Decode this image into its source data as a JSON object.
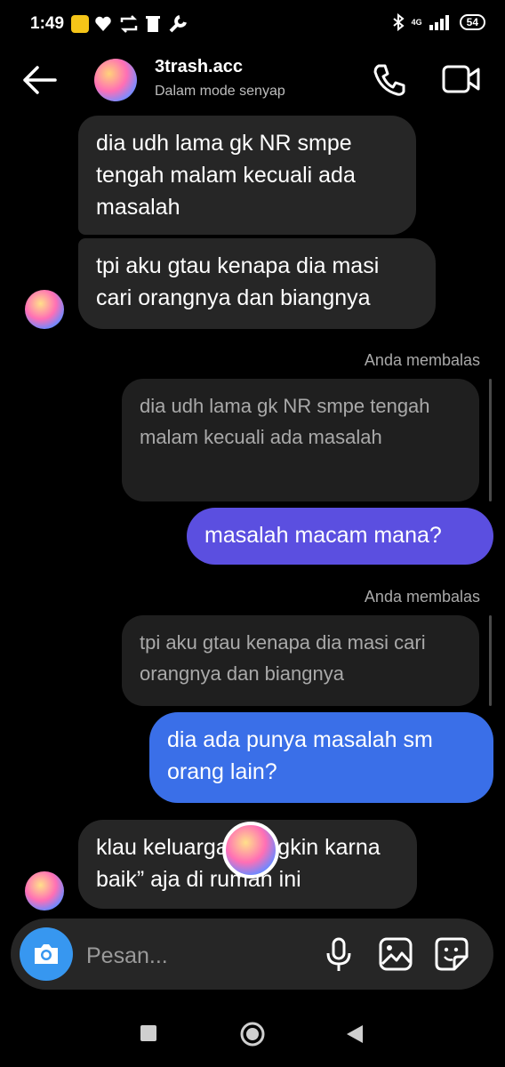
{
  "status": {
    "time": "1:49",
    "network": "4G",
    "battery": "54"
  },
  "header": {
    "title": "3trash.acc",
    "subtitle": "Dalam mode senyap"
  },
  "messages": {
    "m1": "dia udh lama gk NR smpe tengah malam kecuali ada masalah",
    "m2": "tpi aku gtau kenapa dia masi cari orangnya dan biangnya",
    "reply1_label": "Anda membalas",
    "reply1_quote": "dia udh lama gk NR smpe tengah malam kecuali ada masalah",
    "reply1_text": "masalah macam mana?",
    "reply2_label": "Anda membalas",
    "reply2_quote": "tpi aku gtau kenapa dia masi cari orangnya dan biangnya",
    "reply2_text": "dia ada punya masalah sm orang lain?",
    "m3": "klau keluarga mungkin karna baik” aja di rumah ini"
  },
  "composer": {
    "placeholder": "Pesan..."
  },
  "colors": {
    "purple": "#5b4fe0",
    "blue": "#3a6fe8",
    "camera": "#3797f0"
  },
  "icons": [
    "back-arrow-icon",
    "phone-icon",
    "video-icon",
    "camera-icon",
    "microphone-icon",
    "gallery-icon",
    "sticker-icon"
  ]
}
